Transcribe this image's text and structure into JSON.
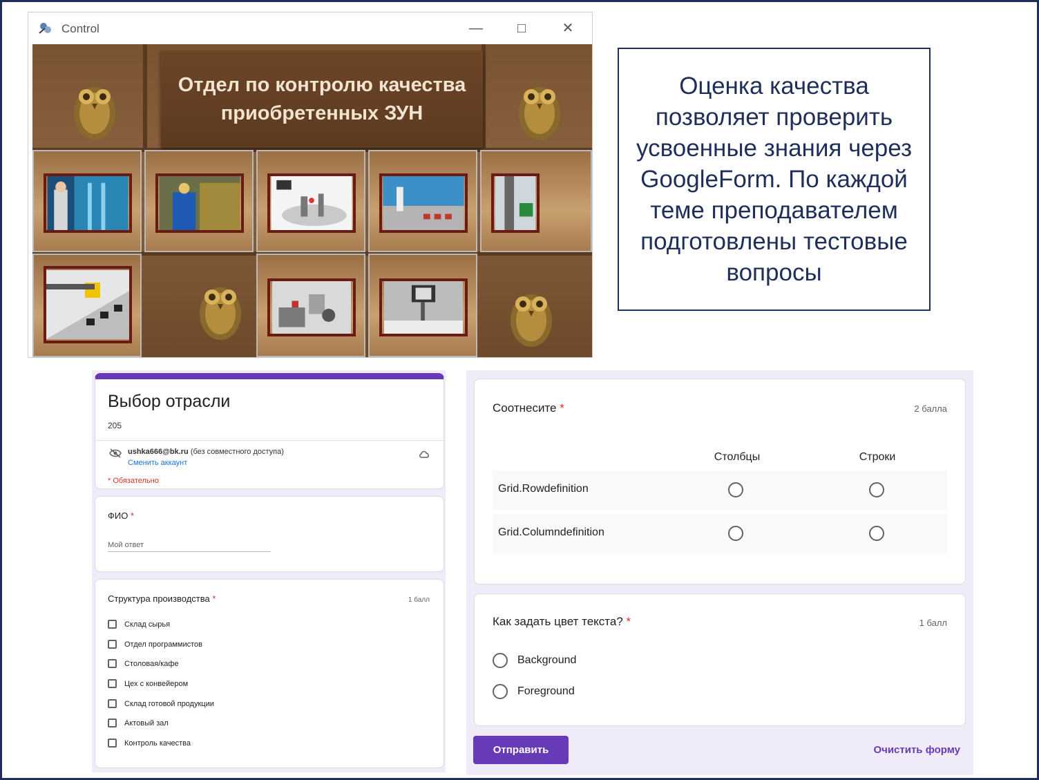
{
  "window": {
    "title": "Control",
    "banner_text": "Отдел по контролю качества приобретенных ЗУН"
  },
  "info_box": {
    "text": "Оценка качества позволяет проверить усвоенные знания через GoogleForm. По каждой теме преподавателем подготовлены тестовые вопросы"
  },
  "form_left": {
    "title": "Выбор отрасли",
    "description": "205",
    "account_email": "ushka666@bk.ru",
    "account_note": "(без совместного доступа)",
    "switch_account": "Сменить аккаунт",
    "required_note": "* Обязательно",
    "fio_label": "ФИО",
    "fio_placeholder": "Мой ответ",
    "structure_label": "Структура производства",
    "structure_points": "1 балл",
    "structure_options": [
      "Склад сырья",
      "Отдел программистов",
      "Столовая/кафе",
      "Цех с конвейером",
      "Склад готовой продукции",
      "Актовый зал",
      "Контроль качества"
    ],
    "required_star": "*"
  },
  "form_right": {
    "grid_question": "Соотнесите",
    "grid_points": "2 балла",
    "grid_columns": [
      "Столбцы",
      "Строки"
    ],
    "grid_rows": [
      "Grid.Rowdefinition",
      "Grid.Columndefinition"
    ],
    "color_question": "Как задать цвет текста?",
    "color_points": "1 балл",
    "color_options": [
      "Background",
      "Foreground"
    ],
    "submit_label": "Отправить",
    "clear_label": "Очистить форму",
    "required_star": "*"
  },
  "colors": {
    "accent": "#673ab7",
    "navy": "#1f2f5a",
    "required": "#d93025",
    "form_bg": "#f0ebf8"
  }
}
